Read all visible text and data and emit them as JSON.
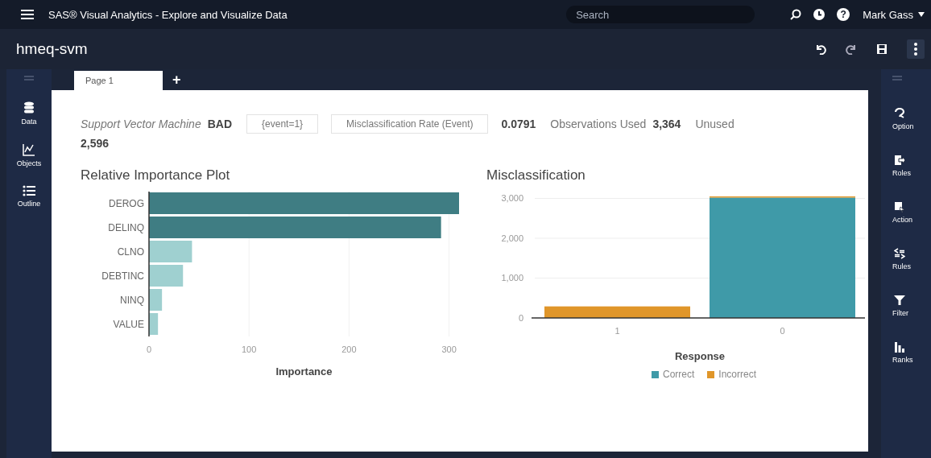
{
  "window": {
    "title": "SAS® Visual Analytics - Explore and Visualize Data",
    "search": {
      "placeholder": "Search"
    },
    "help": "?",
    "user": "Mark Gass"
  },
  "report": {
    "title": "hmeq-svm"
  },
  "tabs": [
    {
      "label": "Page 1",
      "selected": true
    }
  ],
  "add_tab": "+",
  "left_rail": [
    {
      "label": "Data"
    },
    {
      "label": "Objects"
    },
    {
      "label": "Outline"
    }
  ],
  "right_rail": [
    {
      "label": "Option"
    },
    {
      "label": "Roles"
    },
    {
      "label": "Action"
    },
    {
      "label": "Rules"
    },
    {
      "label": "Filter"
    },
    {
      "label": "Ranks"
    }
  ],
  "summary": [
    {
      "kind": "italic",
      "text": "Support Vector Machine"
    },
    {
      "kind": "bold",
      "text": "BAD"
    },
    {
      "kind": "box",
      "text": "{event=1}"
    },
    {
      "kind": "box",
      "text": "Misclassification Rate (Event)"
    },
    {
      "kind": "bold",
      "text": "0.0791"
    },
    {
      "kind": "plain",
      "text": "Observations Used"
    },
    {
      "kind": "bold",
      "text": "3,364"
    },
    {
      "kind": "plain",
      "text": "Unused"
    },
    {
      "kind": "bold",
      "text": "2,596"
    }
  ],
  "importance_chart": {
    "chart_data": {
      "type": "bar",
      "orientation": "horizontal",
      "title": "Relative Importance Plot",
      "xlabel": "Importance",
      "categories": [
        "DEROG",
        "DELINQ",
        "CLNO",
        "DEBTINC",
        "NINQ",
        "VALUE"
      ],
      "values": [
        310,
        292,
        43,
        34,
        13,
        9
      ],
      "xlim": [
        0,
        310
      ],
      "xticks": [
        0,
        100,
        200,
        300
      ],
      "grid": true
    }
  },
  "misclassification_chart": {
    "chart_data": {
      "type": "bar",
      "title": "Misclassification",
      "xlabel": "Response",
      "categories": [
        "1",
        "0"
      ],
      "stacked": true,
      "grid": true,
      "legend": true,
      "ylim": [
        0,
        3050
      ],
      "yticks": [
        {
          "value": 0,
          "label": "0"
        },
        {
          "value": 1000,
          "label": "1,000"
        },
        {
          "value": 2000,
          "label": "2,000"
        },
        {
          "value": 3000,
          "label": "3,000"
        }
      ],
      "series": [
        {
          "name": "Correct",
          "color": "#3f9aa8",
          "values": [
            0,
            3020
          ]
        },
        {
          "name": "Incorrect",
          "color": "#e0962a",
          "values": [
            290,
            30
          ]
        }
      ]
    }
  }
}
